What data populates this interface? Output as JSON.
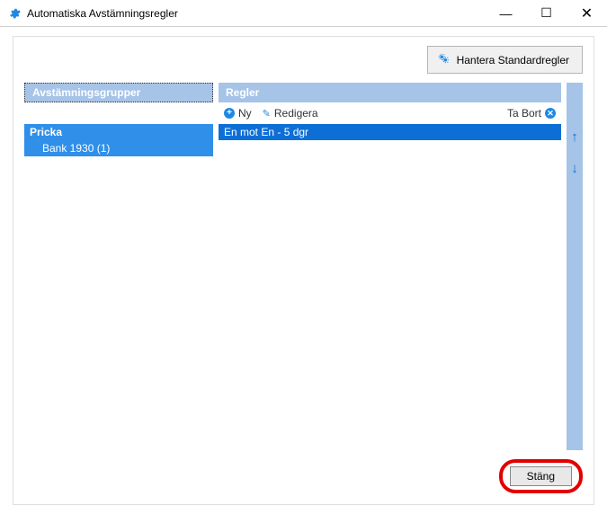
{
  "window": {
    "title": "Automatiska Avstämningsregler"
  },
  "buttons": {
    "manage_standard_rules": "Hantera Standardregler",
    "close": "Stäng"
  },
  "panels": {
    "groups_header": "Avstämningsgrupper",
    "rules_header": "Regler"
  },
  "toolbar": {
    "new": "Ny",
    "edit": "Redigera",
    "delete": "Ta Bort"
  },
  "groups": {
    "name": "Pricka",
    "child": "Bank 1930 (1)"
  },
  "rules": {
    "row": "En mot En - 5 dgr"
  }
}
